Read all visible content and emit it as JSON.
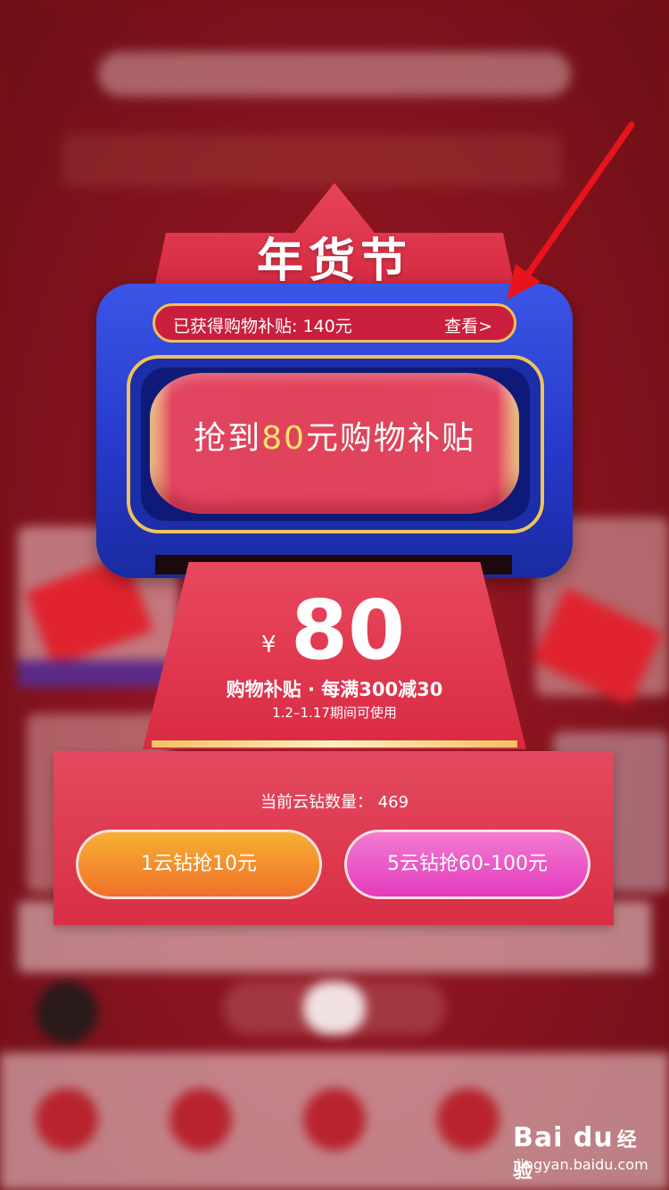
{
  "modal": {
    "title": "年货节",
    "subsidy_pill": {
      "label": "已获得购物补贴: 140元",
      "link": "查看>"
    },
    "grab_button": {
      "prefix": "抢到",
      "amount": "80",
      "suffix": "元购物补贴"
    },
    "coupon": {
      "currency": "¥",
      "value": "80",
      "description": "购物补贴 · 每满300减30",
      "validity": "1.2–1.17期间可使用"
    },
    "diamond_count": "当前云钻数量： 469",
    "buttons": {
      "left_label": "1云钻抢10元",
      "right_label": "5云钻抢60-100元"
    }
  },
  "annotation": {
    "arrow_color": "#e8141b"
  },
  "watermark": {
    "brand": "Bai du",
    "brand_cn": "经验",
    "domain": "jingyan.baidu.com"
  },
  "colors": {
    "frame_blue": "#2438c8",
    "coupon_red": "#d92b43",
    "gold": "#f0c25a",
    "highlight_yellow": "#ffe36a",
    "button_orange": "#f0702a",
    "button_pink": "#e43bbd"
  }
}
